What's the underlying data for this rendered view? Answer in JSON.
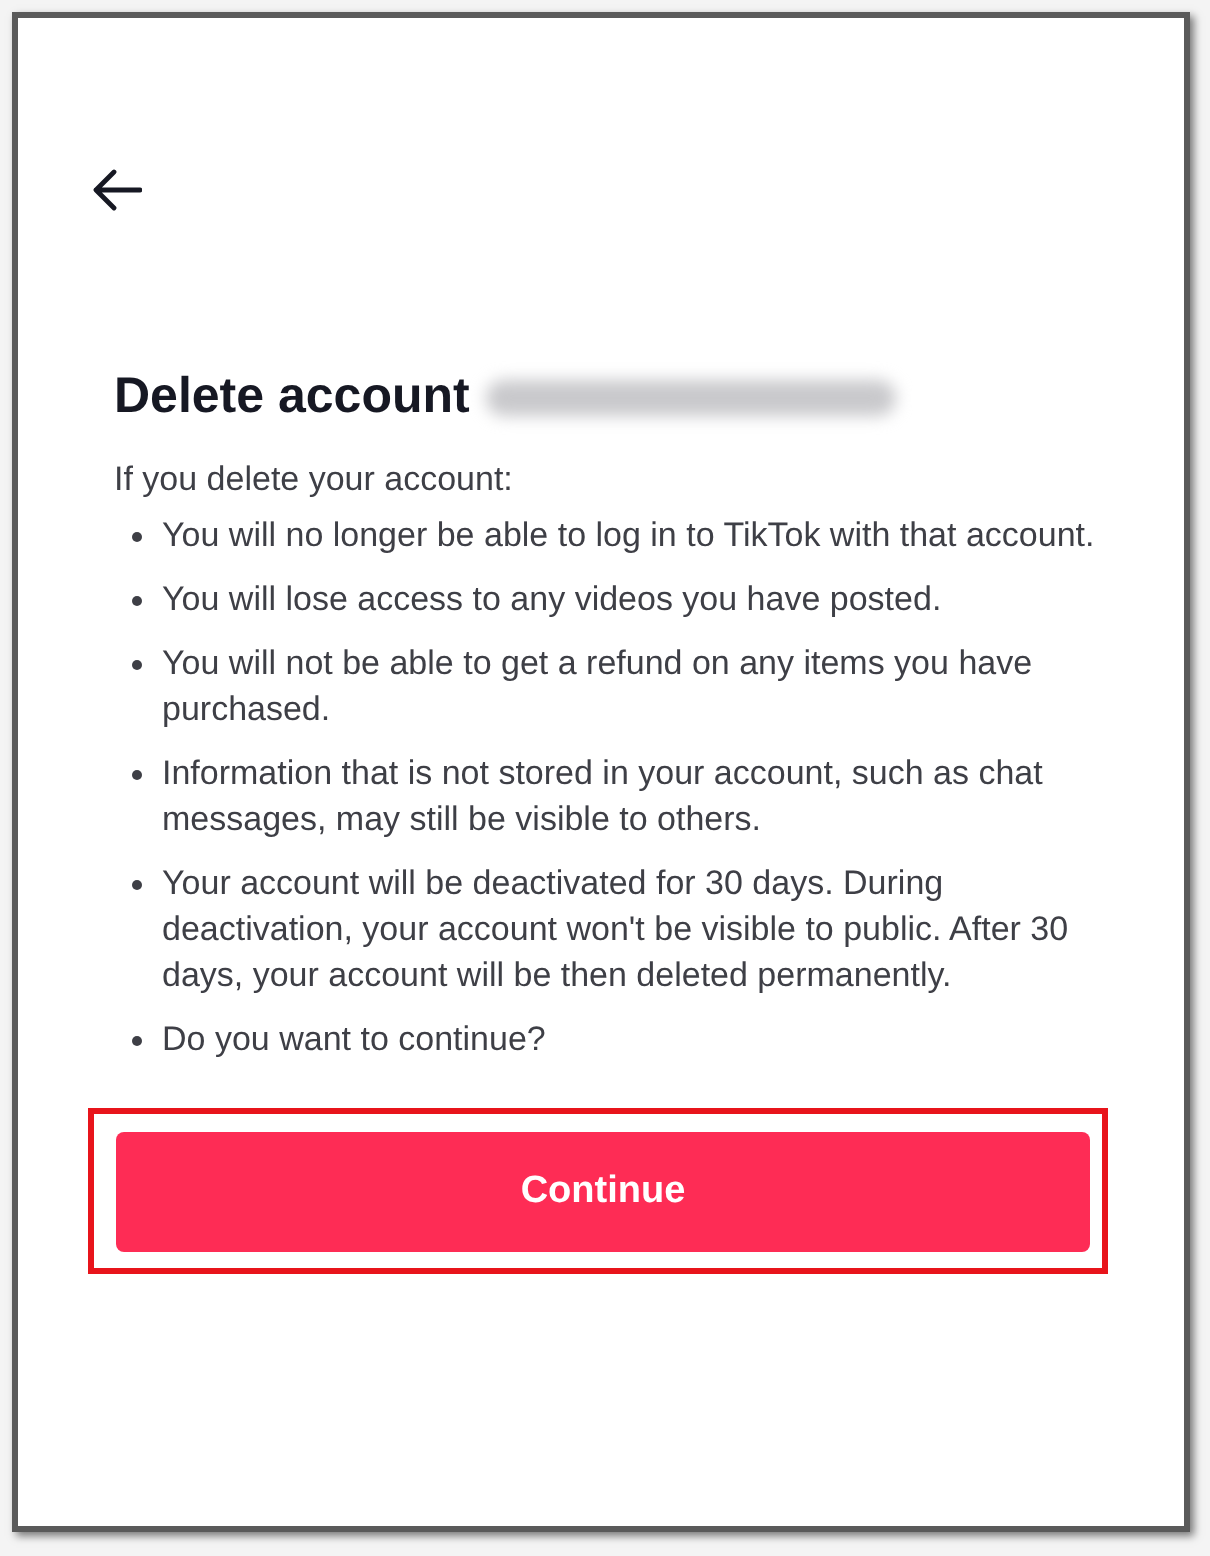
{
  "title": "Delete account",
  "intro": "If you delete your account:",
  "bullets": [
    "You will no longer be able to log in to TikTok with that account.",
    "You will lose access to any videos you have posted.",
    "You will not be able to get a refund on any items you have purchased.",
    "Information that is not stored in your account, such as chat messages, may still be visible to others.",
    "Your account will be deactivated for 30 days. During deactivation, your account won't be visible to public. After 30 days, your account will be then deleted permanently.",
    "Do you want to continue?"
  ],
  "button": {
    "label": "Continue",
    "highlighted": true
  }
}
